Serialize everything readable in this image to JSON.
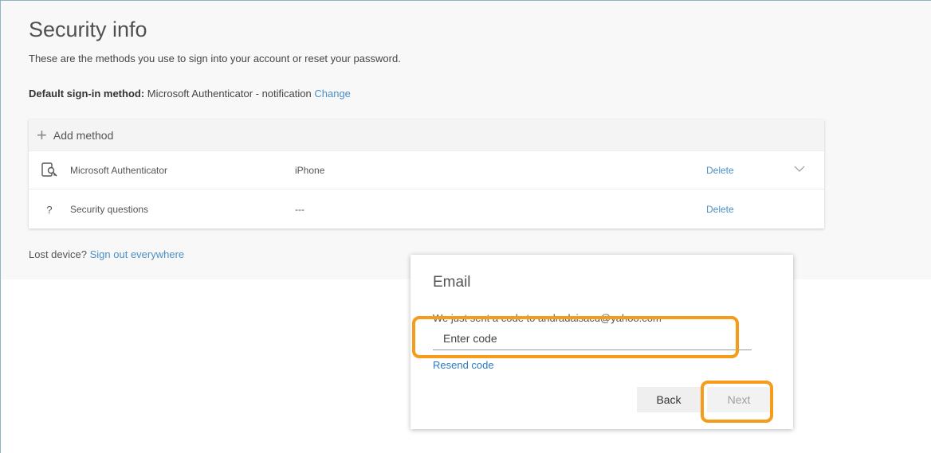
{
  "page": {
    "title": "Security info",
    "subtitle": "These are the methods you use to sign into your account or reset your password.",
    "default_label": "Default sign-in method:",
    "default_value": "Microsoft Authenticator - notification",
    "change_link": "Change",
    "lost_text": "Lost device?",
    "lost_link": "Sign out everywhere"
  },
  "methods": {
    "add_label": "Add method",
    "rows": [
      {
        "icon": "authenticator-icon",
        "name": "Microsoft Authenticator",
        "detail": "iPhone",
        "action": "Delete"
      },
      {
        "icon": "question-icon",
        "name": "Security questions",
        "detail": "---",
        "action": "Delete"
      }
    ]
  },
  "dialog": {
    "title": "Email",
    "message": "We just sent a code to andradaisacu@yahoo.com",
    "code_value": "",
    "code_placeholder": "Enter code",
    "resend_link": "Resend code",
    "back_label": "Back",
    "next_label": "Next"
  },
  "colors": {
    "link": "#4a8fc7",
    "highlight": "#f59c1a"
  }
}
